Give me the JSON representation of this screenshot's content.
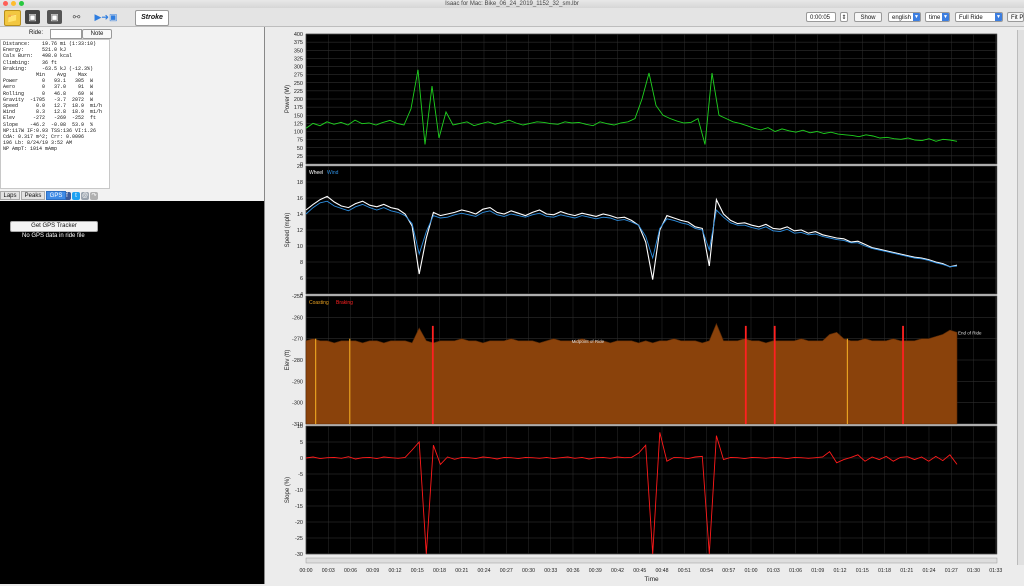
{
  "window": {
    "title": "Isaac for Mac: Bike_06_24_2019_1152_32_sm.lbr",
    "traffic_lights": [
      "#ff5f57",
      "#febc2e",
      "#28c840"
    ]
  },
  "toolbar": {
    "icons": [
      "folder-icon",
      "save-icon",
      "save-as-icon",
      "usb-icon",
      "ride-import-icon",
      "stroke-logo"
    ],
    "logo_text": "Stroke",
    "time_value": "0:00:05",
    "show_label": "Show",
    "language": "english",
    "x_axis_mode": "time",
    "range": "Full Ride",
    "fit_label": "Fit Pl"
  },
  "ride_panel": {
    "ride_label": "Ride:",
    "note_button": "Note",
    "stats_text": "Distance:    19.76 mi (1:33:10)\nEnergy:      521.0 kJ\nCals Burn:   498.0 kcal\nClimbing:    36 ft\nBraking:     -63.5 kJ (-12.3%)\n           Min    Avg    Max\nPower        0   93.1   305  W\nAero         0   37.0    91  W\nRolling      0   46.8    69  W\nGravity  -1705   -3.7  2072  W\nSpeed      0.0   12.7  18.9  mi/h\nWind       8.3   12.8  18.9  mi/h\nElev      -272   -269  -252  ft\nSlope    -46.2  -0.08  53.9  %\nNP:117W IF:0.93 TSS:136 VI:1.26\nCdA: 0.317 m^2; Crr: 0.0096\n196 Lb: 8/24/19 3:52 AM\nNP AmpT: 1014 mAmp",
    "share_icons": [
      "facebook-icon",
      "twitter-icon",
      "email-icon",
      "share-icon"
    ],
    "tabs": [
      "Laps",
      "Peaks",
      "GPS"
    ],
    "gps_button": "Get GPS Tracker",
    "gps_message": "No GPS data in ride file"
  },
  "chart_data": [
    {
      "type": "line",
      "name": "power",
      "ylabel": "Power (W)",
      "ylim": [
        0,
        400
      ],
      "yticks": [
        0,
        25,
        50,
        75,
        100,
        125,
        150,
        175,
        200,
        225,
        250,
        275,
        300,
        325,
        350,
        375,
        400
      ],
      "color": "#1fd11f",
      "grid": true,
      "series": [
        {
          "values": [
            110,
            125,
            118,
            130,
            122,
            128,
            120,
            135,
            124,
            126,
            120,
            128,
            134,
            125,
            120,
            170,
            290,
            60,
            240,
            80,
            160,
            120,
            125,
            130,
            118,
            124,
            130,
            122,
            128,
            135,
            126,
            120,
            125,
            130,
            128,
            124,
            122,
            130,
            126,
            128,
            122,
            118,
            130,
            124,
            120,
            126,
            130,
            140,
            200,
            280,
            180,
            150,
            140,
            132,
            126,
            128,
            140,
            60,
            280,
            150,
            140,
            130,
            125,
            118,
            110,
            105,
            112,
            100,
            108,
            102,
            98,
            104,
            96,
            100,
            94,
            98,
            92,
            90,
            88,
            84,
            90,
            86,
            80,
            82,
            78,
            76,
            80,
            74,
            72,
            78,
            70,
            76,
            74,
            70
          ]
        }
      ]
    },
    {
      "type": "line",
      "name": "speed",
      "ylabel": "Speed (mph)",
      "ylim": [
        4,
        20
      ],
      "yticks": [
        4,
        6,
        8,
        10,
        12,
        14,
        16,
        18,
        20
      ],
      "legend": [
        "Wheel",
        "Wind"
      ],
      "legend_position": "top-left",
      "series": [
        {
          "name": "Wheel",
          "color": "#ffffff",
          "values": [
            14.5,
            15.2,
            15.8,
            16.2,
            15.5,
            15.0,
            14.8,
            15.3,
            15.6,
            15.1,
            14.9,
            15.2,
            14.8,
            14.6,
            14.0,
            12.5,
            6.5,
            11.0,
            14.2,
            13.8,
            14.0,
            14.2,
            14.5,
            14.3,
            14.0,
            14.6,
            14.8,
            14.2,
            14.0,
            14.4,
            14.1,
            13.8,
            14.2,
            14.5,
            14.0,
            13.9,
            14.3,
            14.0,
            13.8,
            14.1,
            13.9,
            13.7,
            14.0,
            13.8,
            13.5,
            13.6,
            13.2,
            12.6,
            10.5,
            5.8,
            12.0,
            13.8,
            13.5,
            13.2,
            13.0,
            12.4,
            12.2,
            7.5,
            15.8,
            14.0,
            13.2,
            12.8,
            12.9,
            12.6,
            12.4,
            12.7,
            12.2,
            12.1,
            12.4,
            11.9,
            12.0,
            11.6,
            11.8,
            11.4,
            11.2,
            11.0,
            10.9,
            10.5,
            10.6,
            10.2,
            9.8,
            9.6,
            9.4,
            9.2,
            9.0,
            8.8,
            8.6,
            8.5,
            8.3,
            8.0,
            7.8,
            7.4,
            7.6
          ]
        },
        {
          "name": "Wind",
          "color": "#2f8fe0",
          "values": [
            14.0,
            14.8,
            15.4,
            15.6,
            15.0,
            14.7,
            14.4,
            14.9,
            15.2,
            14.8,
            14.5,
            14.8,
            14.4,
            14.2,
            13.8,
            12.8,
            9.0,
            11.8,
            13.8,
            13.5,
            13.6,
            13.9,
            14.1,
            13.9,
            13.7,
            14.2,
            14.4,
            13.9,
            13.7,
            14.0,
            13.8,
            13.6,
            13.9,
            14.1,
            13.7,
            13.6,
            13.9,
            13.7,
            13.5,
            13.8,
            13.6,
            13.4,
            13.6,
            13.5,
            13.2,
            13.3,
            13.0,
            12.6,
            11.2,
            8.5,
            12.2,
            13.4,
            13.2,
            12.9,
            12.7,
            12.2,
            12.0,
            9.5,
            14.5,
            13.6,
            12.9,
            12.6,
            12.6,
            12.3,
            12.1,
            12.4,
            11.9,
            11.8,
            12.1,
            11.6,
            11.7,
            11.4,
            11.5,
            11.2,
            11.0,
            10.8,
            10.7,
            10.4,
            10.4,
            10.0,
            9.7,
            9.5,
            9.3,
            9.1,
            8.9,
            8.7,
            8.5,
            8.4,
            8.2,
            7.9,
            7.7,
            7.4,
            7.5
          ]
        }
      ]
    },
    {
      "type": "area",
      "name": "elevation",
      "ylabel": "Elev (ft)",
      "ylim": [
        -310,
        -250
      ],
      "yticks": [
        -310,
        -300,
        -290,
        -280,
        -270,
        -260,
        -250
      ],
      "legend": [
        "Coasting",
        "Braking"
      ],
      "legend_position": "top-left",
      "legend_colors": [
        "#e8a020",
        "#ff2020"
      ],
      "fill_color": "#8a420b",
      "annotations": [
        "Midpoint of Ride",
        "End of Ride"
      ],
      "coasting_markers_time_min": [
        1.3,
        5.9,
        73.0
      ],
      "braking_markers_time_min": [
        17.1,
        59.3,
        63.2,
        80.5
      ],
      "series": [
        {
          "values": [
            -271,
            -270,
            -271,
            -271,
            -272,
            -271,
            -271,
            -271,
            -272,
            -271,
            -271,
            -272,
            -271,
            -271,
            -271,
            -272,
            -265,
            -271,
            -272,
            -271,
            -271,
            -271,
            -270,
            -271,
            -271,
            -272,
            -271,
            -271,
            -271,
            -270,
            -271,
            -271,
            -271,
            -272,
            -271,
            -270,
            -271,
            -271,
            -271,
            -270,
            -271,
            -271,
            -271,
            -272,
            -271,
            -271,
            -271,
            -272,
            -271,
            -272,
            -271,
            -271,
            -270,
            -271,
            -271,
            -271,
            -272,
            -271,
            -263,
            -271,
            -271,
            -271,
            -270,
            -271,
            -271,
            -272,
            -271,
            -271,
            -271,
            -271,
            -270,
            -271,
            -271,
            -271,
            -268,
            -267,
            -270,
            -271,
            -271,
            -270,
            -271,
            -271,
            -271,
            -270,
            -271,
            -271,
            -271,
            -270,
            -270,
            -269,
            -268,
            -266,
            -267
          ]
        }
      ]
    },
    {
      "type": "line",
      "name": "slope",
      "ylabel": "Slope (%)",
      "ylim": [
        -30,
        10
      ],
      "yticks": [
        -30,
        -25,
        -20,
        -15,
        -10,
        -5,
        0,
        5,
        10
      ],
      "color": "#ff1a1a",
      "grid": true,
      "series": [
        {
          "values": [
            0,
            0.3,
            -0.2,
            0.1,
            0.2,
            -0.1,
            0.4,
            -0.3,
            0.1,
            0.2,
            -0.2,
            0.3,
            0.1,
            -0.1,
            0.2,
            2.5,
            5,
            -30,
            4,
            -2,
            0.3,
            -0.4,
            0.2,
            0.1,
            -0.2,
            0.3,
            0.1,
            -0.3,
            0.2,
            0.1,
            -0.2,
            0.2,
            0.1,
            -0.1,
            0.2,
            -0.2,
            0.1,
            0.3,
            -0.1,
            0.2,
            -0.3,
            0.1,
            0.2,
            -0.1,
            0.3,
            0.1,
            0.2,
            1.5,
            4,
            -30,
            8,
            -1,
            0.2,
            0.1,
            -0.2,
            0.3,
            0.5,
            -30,
            7,
            -0.5,
            0.2,
            0.1,
            -0.2,
            0.2,
            0.1,
            -0.1,
            0.2,
            0.1,
            -0.2,
            0.2,
            0.1,
            -0.1,
            0.1,
            0.3,
            2,
            -1.5,
            -0.5,
            0.2,
            1,
            -1,
            0.3,
            -0.5,
            0.5,
            -1,
            0.2,
            0.4,
            -0.5,
            0.3,
            -1,
            0.5,
            -0.8,
            1,
            -2
          ]
        }
      ]
    }
  ],
  "x_axis": {
    "label": "Time",
    "ticks": [
      "00:00",
      "00:03",
      "00:06",
      "00:09",
      "00:12",
      "00:15",
      "00:18",
      "00:21",
      "00:24",
      "00:27",
      "00:30",
      "00:33",
      "00:36",
      "00:39",
      "00:42",
      "00:45",
      "00:48",
      "00:51",
      "00:54",
      "00:57",
      "01:00",
      "01:03",
      "01:06",
      "01:09",
      "01:12",
      "01:15",
      "01:18",
      "01:21",
      "01:24",
      "01:27",
      "01:30",
      "01:33"
    ]
  }
}
